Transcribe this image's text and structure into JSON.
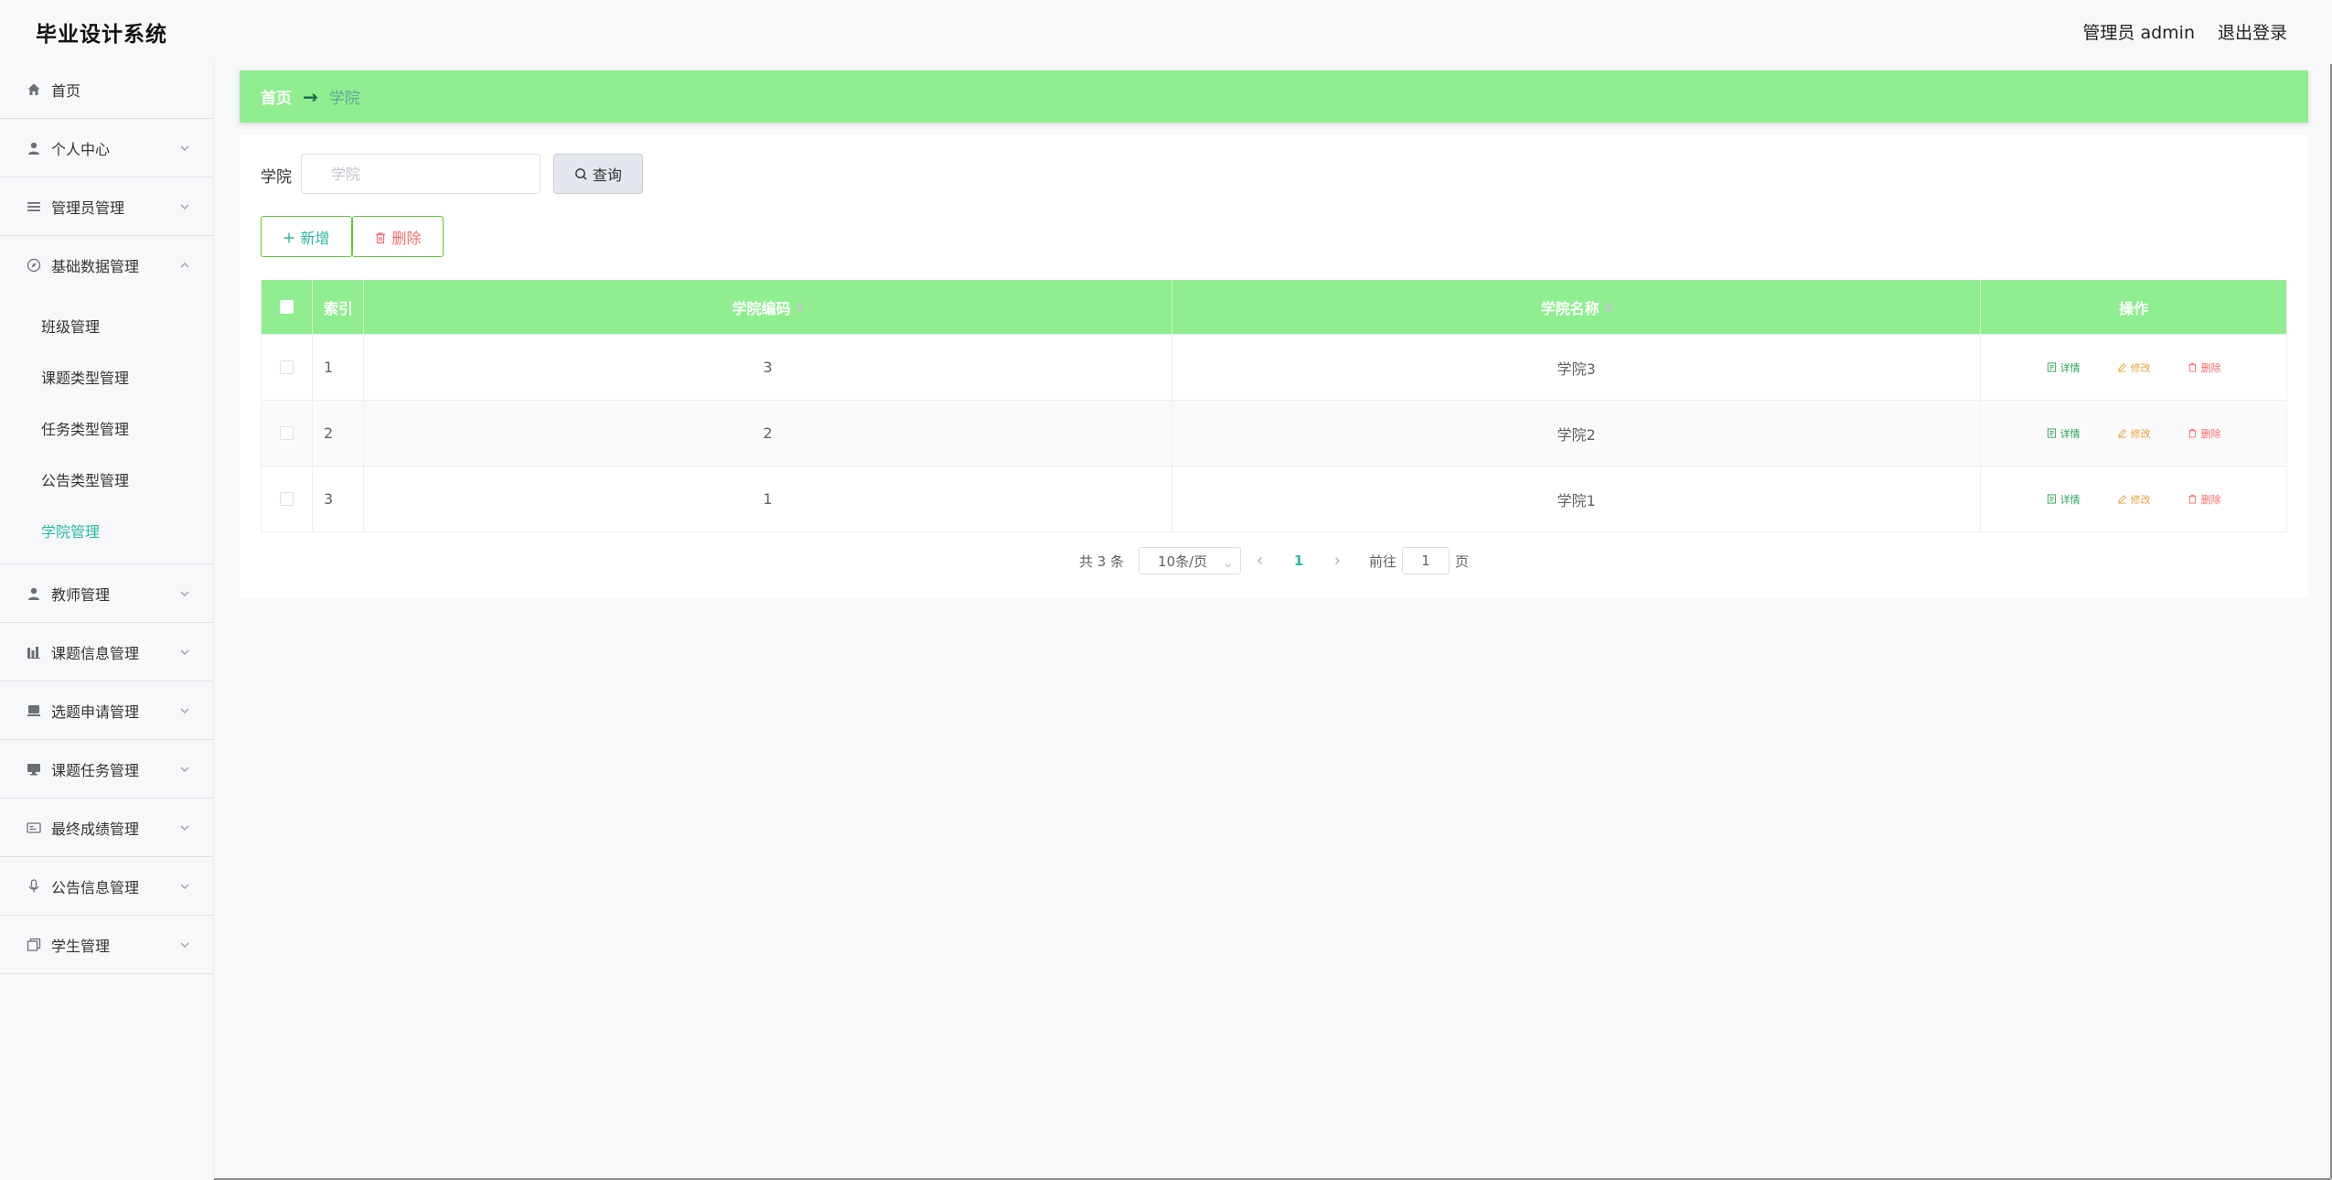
{
  "header": {
    "app_title": "毕业设计系统",
    "user_label": "管理员 admin",
    "logout_label": "退出登录"
  },
  "sidebar": {
    "items": [
      {
        "label": "首页",
        "icon": "home-icon"
      },
      {
        "label": "个人中心",
        "icon": "user-icon"
      },
      {
        "label": "管理员管理",
        "icon": "list-icon"
      },
      {
        "label": "基础数据管理",
        "icon": "compass-icon",
        "expanded": true,
        "children": [
          "班级管理",
          "课题类型管理",
          "任务类型管理",
          "公告类型管理",
          "学院管理"
        ],
        "active_child": "学院管理"
      },
      {
        "label": "教师管理",
        "icon": "user-icon"
      },
      {
        "label": "课题信息管理",
        "icon": "chart-icon"
      },
      {
        "label": "选题申请管理",
        "icon": "folder-icon"
      },
      {
        "label": "课题任务管理",
        "icon": "monitor-icon"
      },
      {
        "label": "最终成绩管理",
        "icon": "card-icon"
      },
      {
        "label": "公告信息管理",
        "icon": "microphone-icon"
      },
      {
        "label": "学生管理",
        "icon": "copy-icon"
      }
    ]
  },
  "breadcrumb": {
    "home": "首页",
    "separator": "→",
    "current": "学院"
  },
  "search": {
    "label": "学院",
    "placeholder": "学院",
    "value": "",
    "button": "查询"
  },
  "actions": {
    "add": "新增",
    "delete": "删除"
  },
  "table": {
    "columns": {
      "index": "索引",
      "code": "学院编码",
      "name": "学院名称",
      "ops": "操作"
    },
    "rows": [
      {
        "index": "1",
        "code": "3",
        "name": "学院3"
      },
      {
        "index": "2",
        "code": "2",
        "name": "学院2"
      },
      {
        "index": "3",
        "code": "1",
        "name": "学院1"
      }
    ],
    "row_ops": {
      "detail": "详情",
      "edit": "修改",
      "remove": "删除"
    }
  },
  "pagination": {
    "total": "共 3 条",
    "page_size": "10条/页",
    "current_page": "1",
    "goto_label": "前往",
    "goto_value": "1",
    "goto_suffix": "页"
  },
  "colors": {
    "accent_green": "#90ee90",
    "active_teal": "#2ab8a0",
    "danger": "#f56c6c",
    "warning": "#e6a23c"
  }
}
